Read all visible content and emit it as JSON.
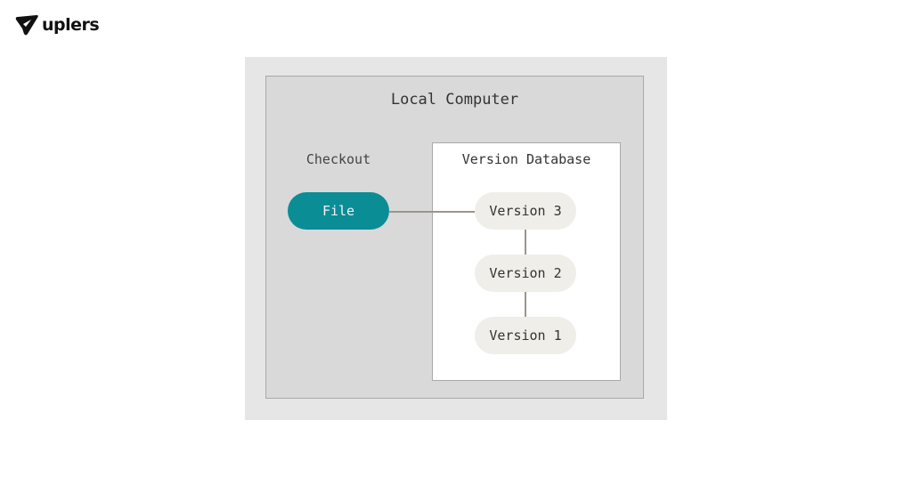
{
  "brand": {
    "name": "uplers",
    "icon": "paper-plane-icon"
  },
  "diagram": {
    "container_label": "Local Computer",
    "checkout_label": "Checkout",
    "working_file": {
      "label": "File",
      "color": "#0b8d96"
    },
    "database": {
      "label": "Version Database",
      "versions": [
        "Version 3",
        "Version 2",
        "Version 1"
      ]
    }
  }
}
